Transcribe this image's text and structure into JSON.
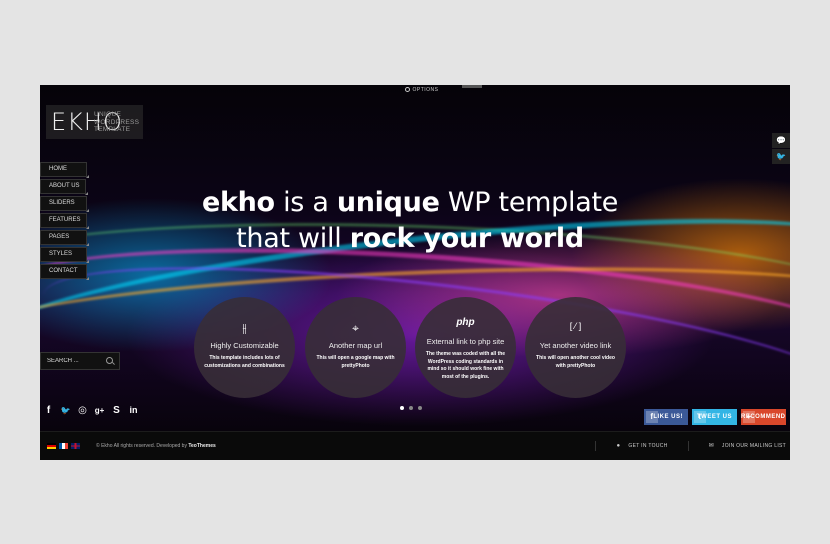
{
  "options": {
    "label": "OPTIONS"
  },
  "logo": {
    "name": "EKHO",
    "tagline": "UNIQUE WORDPRESS TEMPLATE"
  },
  "nav": {
    "items": [
      {
        "label": "HOME"
      },
      {
        "label": "ABOUT US"
      },
      {
        "label": "SLIDERS"
      },
      {
        "label": "FEATURES"
      },
      {
        "label": "PAGES"
      },
      {
        "label": "STYLES"
      },
      {
        "label": "CONTACT"
      }
    ]
  },
  "search": {
    "placeholder": "SEARCH ..."
  },
  "social": {
    "icons": [
      "facebook-icon",
      "twitter-icon",
      "dribbble-icon",
      "google-plus-icon",
      "skype-icon",
      "linkedin-icon"
    ],
    "glyphs": [
      "f",
      "🐦",
      "◎",
      "g+",
      "S",
      "in"
    ]
  },
  "side_icons": {
    "glyphs": [
      "💬",
      "🐦"
    ]
  },
  "headline": {
    "l1_a": "ekho",
    "l1_b": " is a ",
    "l1_c": "unique",
    "l1_d": " WP template",
    "l2_a": "that will ",
    "l2_b": "rock your world"
  },
  "features": [
    {
      "icon": "sliders-icon",
      "glyph": "⫲",
      "title": "Highly Customizable",
      "text": "This template includes lots of customizations and combinations"
    },
    {
      "icon": "map-pin-icon",
      "glyph": "⌖",
      "title": "Another map url",
      "text": "This will open a google map with prettyPhoto"
    },
    {
      "icon": "php-icon",
      "glyph": "php",
      "title": "External link to php site",
      "text": "The theme was coded with all the WordPress coding standards in mind so it should work fine with most of the plugins."
    },
    {
      "icon": "video-link-icon",
      "glyph": "[ ⁄ ]",
      "title": "Yet another video link",
      "text": "This will open another cool video with prettyPhoto"
    }
  ],
  "slider": {
    "dots": 3,
    "active": 1
  },
  "share": {
    "like": "LIKE US!",
    "tweet": "TWEET US",
    "recommend": "RECOMMEND",
    "like_color": "#3b5998",
    "tweet_color": "#33b5e5",
    "recommend_color": "#d9472b"
  },
  "footer": {
    "copyright_prefix": "© Ekho  All rights reserved. Developed by ",
    "developer": "TeoThemes",
    "get_in_touch": "GET IN TOUCH",
    "mailing_list": "JOIN OUR MAILING LIST"
  },
  "flags": [
    "german-flag-icon",
    "french-flag-icon",
    "uk-flag-icon"
  ]
}
